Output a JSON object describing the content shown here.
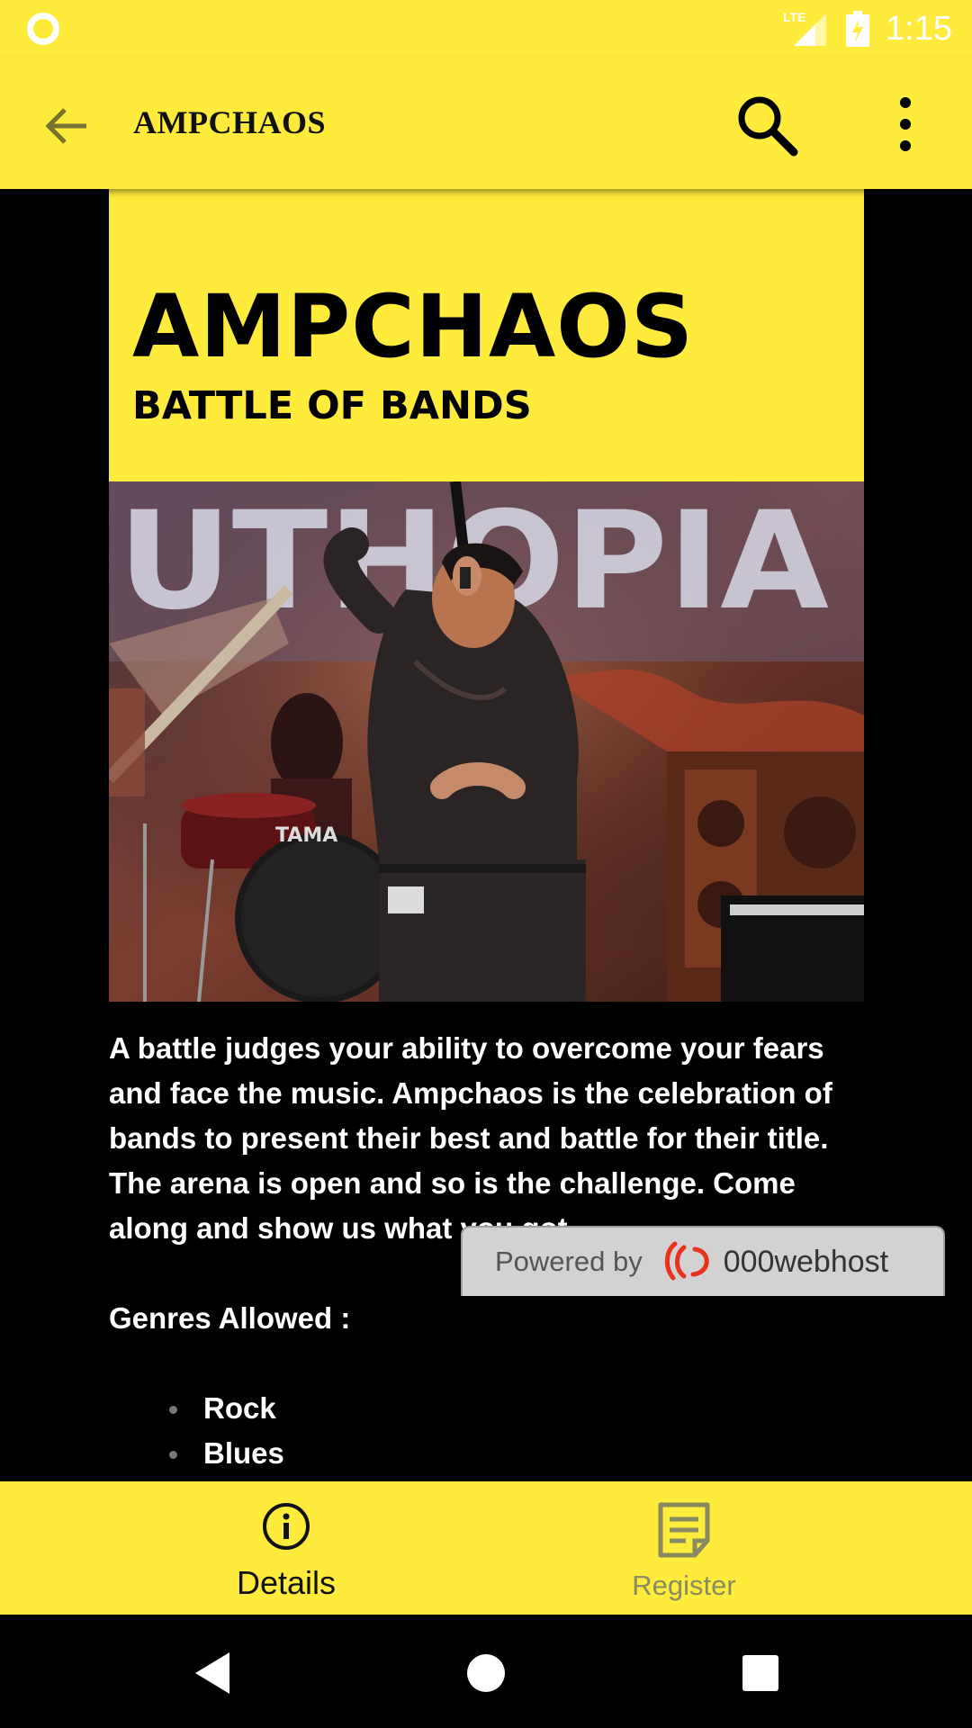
{
  "status_bar": {
    "network": "LTE",
    "time": "1:15"
  },
  "app_bar": {
    "title": "AMPCHAOS",
    "icons": [
      "arrow-back-icon",
      "search-icon",
      "more-vert-icon"
    ]
  },
  "hero": {
    "title": "AMPCHAOS",
    "subtitle": "BATTLE OF BANDS"
  },
  "photo": {
    "banner_text": "UTHOPIA",
    "drum_brand": "TAMA"
  },
  "description": {
    "paragraph": "A battle judges your ability to overcome your fears and face the music. Ampchaos is the celebration of bands to present their best and battle for their title. The arena is open and so is the challenge. Come along and show us what you got.",
    "genres_title": "Genres Allowed :",
    "genres": [
      "Rock",
      "Blues"
    ]
  },
  "badge": {
    "prefix": "Powered by",
    "brand": "000webhost"
  },
  "bottom_nav": {
    "items": [
      {
        "label": "Details",
        "icon": "info-icon",
        "active": true
      },
      {
        "label": "Register",
        "icon": "note-icon",
        "active": false
      }
    ]
  },
  "colors": {
    "primary": "#ffeb3b",
    "background": "#000000",
    "text_light": "#ffffff",
    "inactive": "#8a8a62"
  }
}
